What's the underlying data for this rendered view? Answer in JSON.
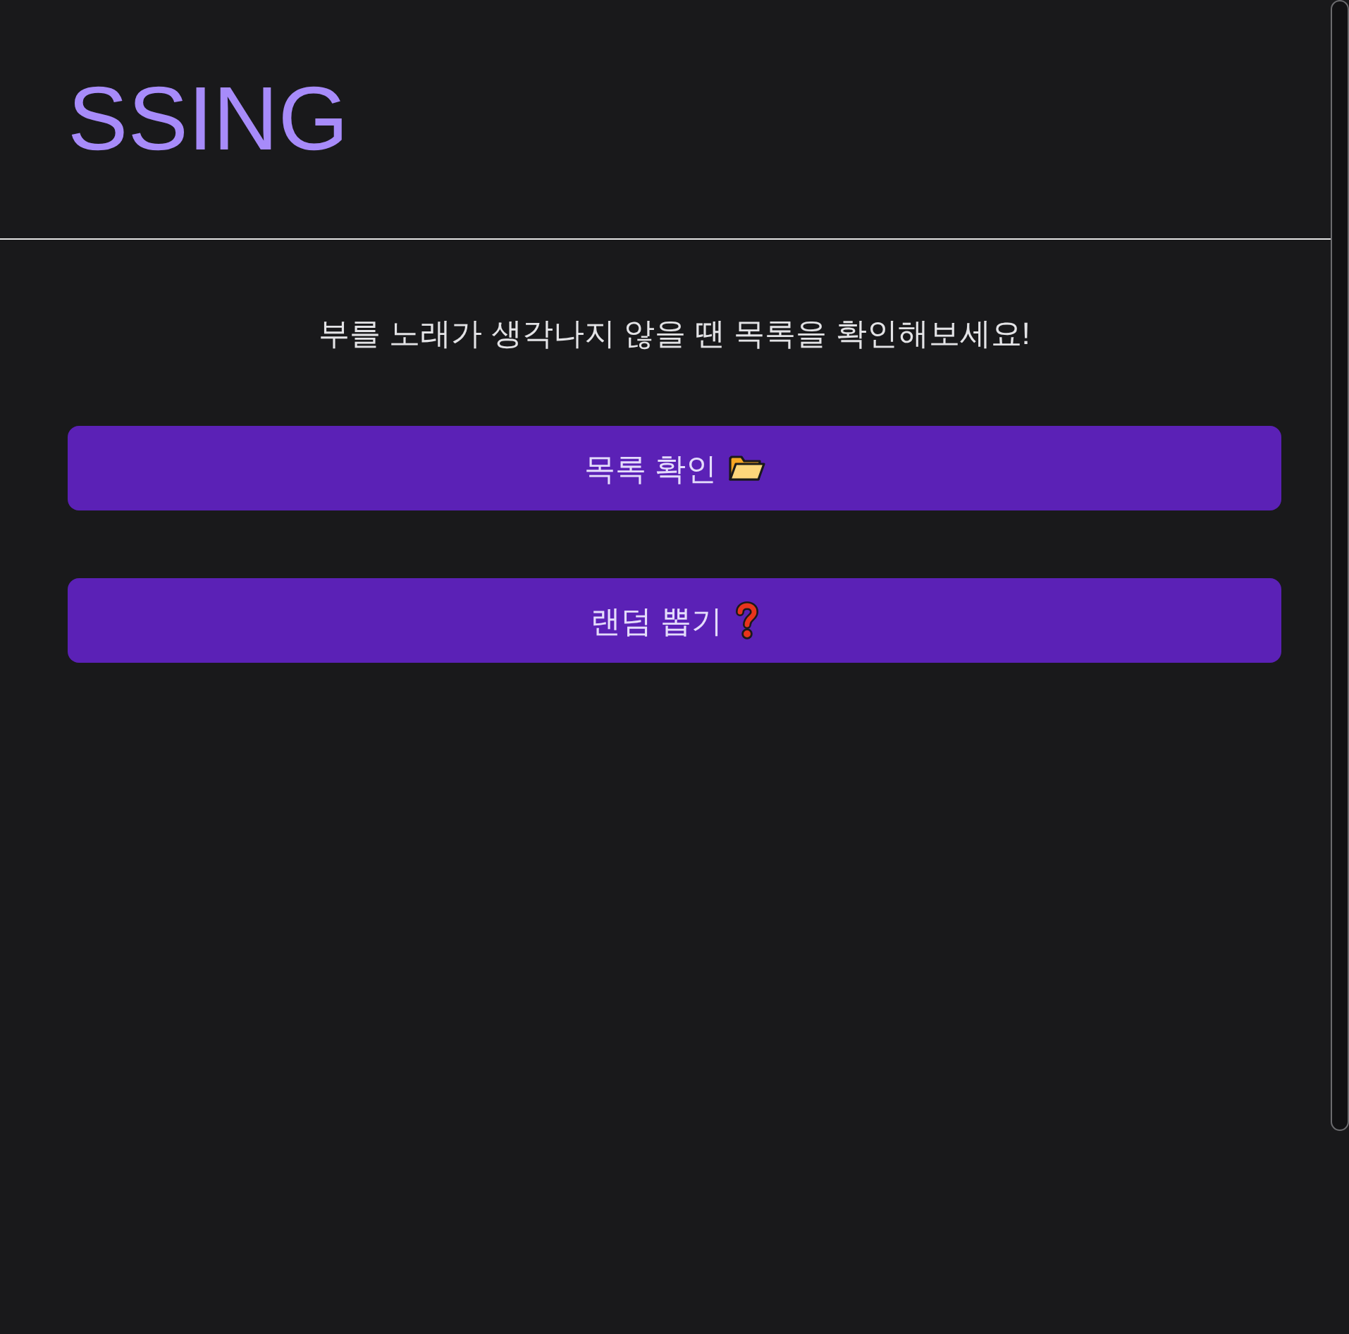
{
  "header": {
    "title": "SSING"
  },
  "intro": {
    "text": "부를 노래가 생각나지 않을 땐 목록을 확인해보세요!"
  },
  "buttons": [
    {
      "label": "목록 확인",
      "kind": "folder"
    },
    {
      "label": "랜덤 뽑기",
      "kind": "question"
    }
  ]
}
